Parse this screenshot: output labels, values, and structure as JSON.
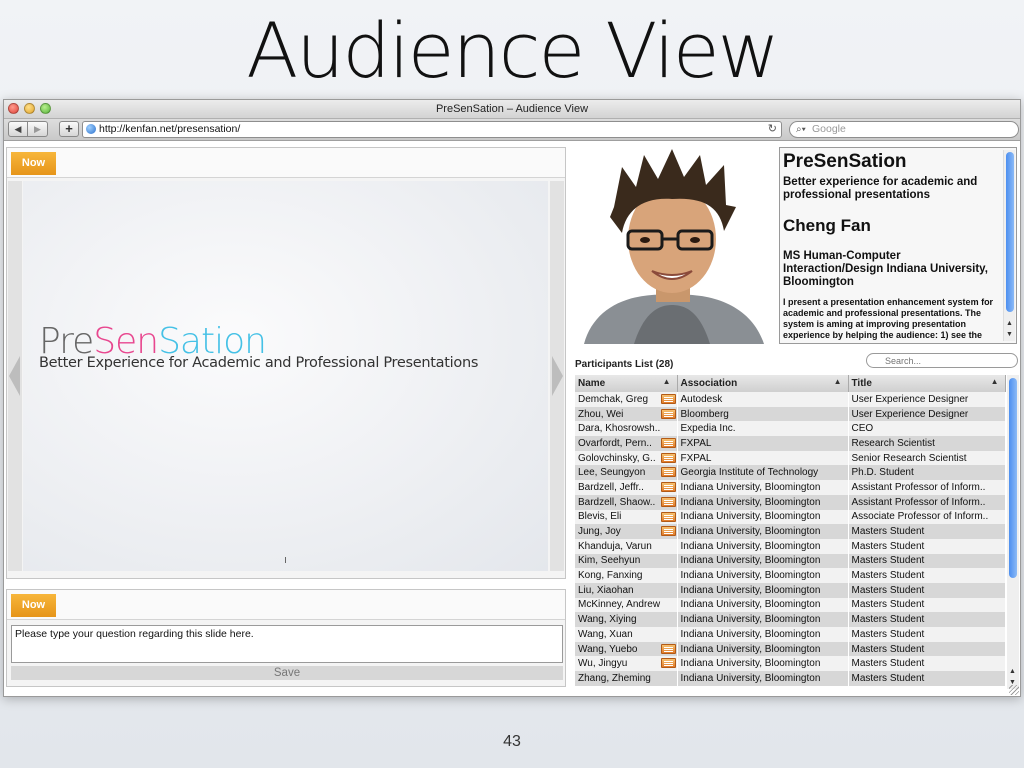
{
  "slide": {
    "title": "Audience View",
    "number": "43"
  },
  "window": {
    "title": "PreSenSation – Audience View",
    "url": "http://kenfan.net/presensation/",
    "search_placeholder": "Google"
  },
  "slide_panel": {
    "now_label": "Now",
    "brand_pre": "Pre",
    "brand_sen": "Sen",
    "brand_sation": "Sation",
    "subtitle": "Better Experience for Academic and Professional Presentations"
  },
  "question_panel": {
    "now_label": "Now",
    "input_value": "Please type your question regarding this slide here.",
    "save_label": "Save"
  },
  "presenter": {
    "app_name": "PreSenSation",
    "tagline": "Better experience for academic and professional presentations",
    "name": "Cheng Fan",
    "affiliation": "MS Human-Computer Interaction/Design Indiana University, Bloomington",
    "abstract": "I present a presentation enhancement system for academic and professional presentations. The system is aming at improving presentation experience by helping the audience: 1) see the"
  },
  "participants": {
    "title": "Participants List (28)",
    "search_placeholder": "Search...",
    "columns": [
      "Name",
      "Association",
      "Title"
    ],
    "rows": [
      {
        "name": "Demchak, Greg",
        "flag": true,
        "association": "Autodesk",
        "title": "User Experience Designer"
      },
      {
        "name": "Zhou, Wei",
        "flag": true,
        "association": "Bloomberg",
        "title": "User Experience Designer"
      },
      {
        "name": "Dara, Khosrowsh..",
        "flag": false,
        "association": "Expedia Inc.",
        "title": "CEO"
      },
      {
        "name": "Ovarfordt, Pern..",
        "flag": true,
        "association": "FXPAL",
        "title": "Research Scientist"
      },
      {
        "name": "Golovchinsky, G..",
        "flag": true,
        "association": "FXPAL",
        "title": "Senior Research Scientist"
      },
      {
        "name": "Lee, Seungyon",
        "flag": true,
        "association": "Georgia Institute of Technology",
        "title": "Ph.D. Student"
      },
      {
        "name": "Bardzell, Jeffr..",
        "flag": true,
        "association": "Indiana University, Bloomington",
        "title": "Assistant Professor of Inform.."
      },
      {
        "name": "Bardzell, Shaow..",
        "flag": true,
        "association": "Indiana University, Bloomington",
        "title": "Assistant Professor of Inform.."
      },
      {
        "name": "Blevis, Eli",
        "flag": true,
        "association": "Indiana University, Bloomington",
        "title": "Associate Professor of Inform.."
      },
      {
        "name": "Jung, Joy",
        "flag": true,
        "association": "Indiana University, Bloomington",
        "title": "Masters Student"
      },
      {
        "name": "Khanduja, Varun",
        "flag": false,
        "association": "Indiana University, Bloomington",
        "title": "Masters Student"
      },
      {
        "name": "Kim, Seehyun",
        "flag": false,
        "association": "Indiana University, Bloomington",
        "title": "Masters Student"
      },
      {
        "name": "Kong, Fanxing",
        "flag": false,
        "association": "Indiana University, Bloomington",
        "title": "Masters Student"
      },
      {
        "name": "Liu, Xiaohan",
        "flag": false,
        "association": "Indiana University, Bloomington",
        "title": "Masters Student"
      },
      {
        "name": "McKinney, Andrew",
        "flag": false,
        "association": "Indiana University, Bloomington",
        "title": "Masters Student"
      },
      {
        "name": "Wang, Xiying",
        "flag": false,
        "association": "Indiana University, Bloomington",
        "title": "Masters Student"
      },
      {
        "name": "Wang, Xuan",
        "flag": false,
        "association": "Indiana University, Bloomington",
        "title": "Masters Student"
      },
      {
        "name": "Wang, Yuebo",
        "flag": true,
        "association": "Indiana University, Bloomington",
        "title": "Masters Student"
      },
      {
        "name": "Wu, Jingyu",
        "flag": true,
        "association": "Indiana University, Bloomington",
        "title": "Masters Student"
      },
      {
        "name": "Zhang, Zheming",
        "flag": false,
        "association": "Indiana University, Bloomington",
        "title": "Masters Student"
      }
    ]
  },
  "colors": {
    "now_tab": "#e6951a",
    "brand_pink": "#e8478f",
    "brand_cyan": "#45c1e6",
    "scroll_thumb": "#4d8ff0"
  }
}
